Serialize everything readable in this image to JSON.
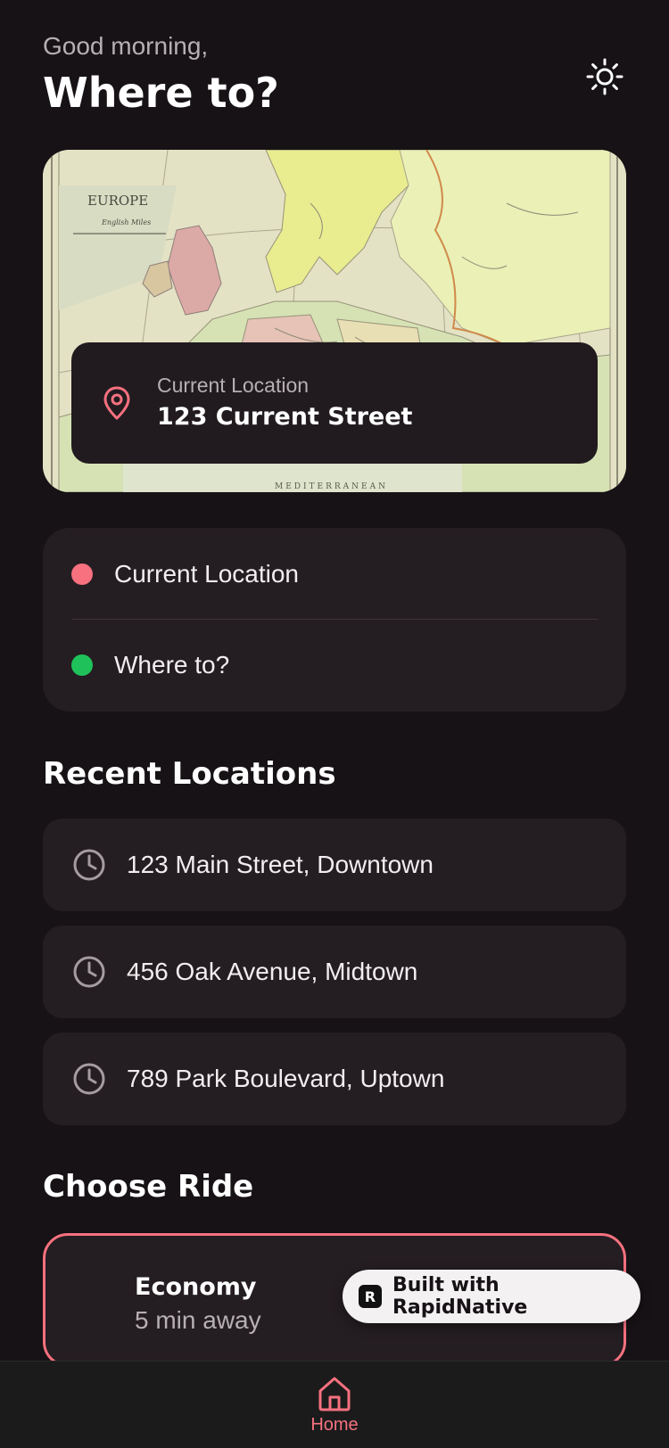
{
  "header": {
    "greeting": "Good morning,",
    "title": "Where to?",
    "theme_icon": "sun-icon"
  },
  "map": {
    "map_label": "EUROPE",
    "scale_label": "English Miles",
    "sea_label": "MEDITERRANEAN",
    "overlay": {
      "label": "Current Location",
      "value": "123 Current Street",
      "icon": "map-pin-icon"
    }
  },
  "route": {
    "from": "Current Location",
    "to": "Where to?",
    "from_color": "#f7717f",
    "to_color": "#1fc25a"
  },
  "recent": {
    "title": "Recent Locations",
    "items": [
      {
        "label": "123 Main Street, Downtown"
      },
      {
        "label": "456 Oak Avenue, Midtown"
      },
      {
        "label": "789 Park Boulevard, Uptown"
      }
    ]
  },
  "ride": {
    "title": "Choose Ride",
    "selected": {
      "name": "Economy",
      "eta": "5 min away"
    }
  },
  "badge": {
    "logo_letter": "R",
    "text": "Built with RapidNative"
  },
  "tabs": {
    "home": {
      "label": "Home",
      "icon": "home-icon"
    }
  },
  "colors": {
    "background": "#161215",
    "card": "#241d21",
    "accent": "#f7717f",
    "success": "#1fc25a"
  }
}
